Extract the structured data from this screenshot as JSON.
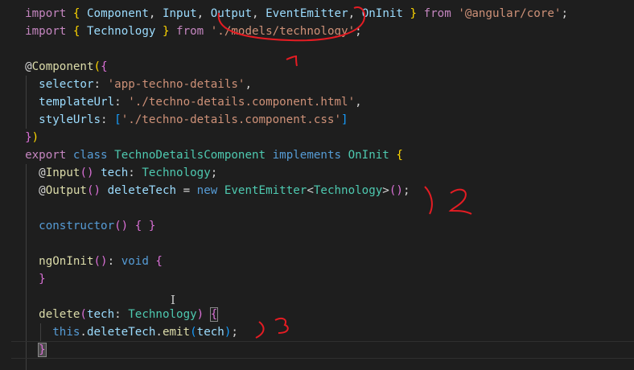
{
  "editor": {
    "language": "typescript",
    "theme_colors": {
      "background": "#1e1e1e",
      "keyword": "#c586c0",
      "storage": "#569cd6",
      "variable": "#9cdcfe",
      "string": "#ce9178",
      "class": "#4ec9b0",
      "function": "#dcdcaa",
      "annotation": "#e51c23"
    },
    "lines": [
      {
        "tokens": [
          [
            "  ",
            "punct"
          ],
          [
            "import",
            "keyword"
          ],
          [
            " ",
            "punct"
          ],
          [
            "{",
            "brace1"
          ],
          [
            " ",
            "punct"
          ],
          [
            "Component",
            "var"
          ],
          [
            ", ",
            "punct"
          ],
          [
            "Input",
            "var"
          ],
          [
            ", ",
            "punct"
          ],
          [
            "Output",
            "var"
          ],
          [
            ", ",
            "punct"
          ],
          [
            "EventEmitter",
            "var"
          ],
          [
            ", ",
            "punct"
          ],
          [
            "OnInit",
            "var"
          ],
          [
            " ",
            "punct"
          ],
          [
            "}",
            "brace1"
          ],
          [
            " ",
            "punct"
          ],
          [
            "from",
            "keyword"
          ],
          [
            " ",
            "punct"
          ],
          [
            "'@angular/core'",
            "string"
          ],
          [
            ";",
            "punct"
          ]
        ]
      },
      {
        "tokens": [
          [
            "  ",
            "punct"
          ],
          [
            "import",
            "keyword"
          ],
          [
            " ",
            "punct"
          ],
          [
            "{",
            "brace1"
          ],
          [
            " ",
            "punct"
          ],
          [
            "Technology",
            "var"
          ],
          [
            " ",
            "punct"
          ],
          [
            "}",
            "brace1"
          ],
          [
            " ",
            "punct"
          ],
          [
            "from",
            "keyword"
          ],
          [
            " ",
            "punct"
          ],
          [
            "'./models/technology'",
            "string"
          ],
          [
            ";",
            "punct"
          ]
        ]
      },
      {
        "tokens": []
      },
      {
        "tokens": [
          [
            "  ",
            "punct"
          ],
          [
            "@",
            "punct"
          ],
          [
            "Component",
            "func"
          ],
          [
            "(",
            "brace1"
          ],
          [
            "{",
            "brace2"
          ]
        ]
      },
      {
        "tokens": [
          [
            "    ",
            "punct"
          ],
          [
            "selector",
            "var"
          ],
          [
            ": ",
            "punct"
          ],
          [
            "'app-techno-details'",
            "string"
          ],
          [
            ",",
            "punct"
          ]
        ]
      },
      {
        "tokens": [
          [
            "    ",
            "punct"
          ],
          [
            "templateUrl",
            "var"
          ],
          [
            ": ",
            "punct"
          ],
          [
            "'./techno-details.component.html'",
            "string"
          ],
          [
            ",",
            "punct"
          ]
        ]
      },
      {
        "tokens": [
          [
            "    ",
            "punct"
          ],
          [
            "styleUrls",
            "var"
          ],
          [
            ": ",
            "punct"
          ],
          [
            "[",
            "brace3"
          ],
          [
            "'./techno-details.component.css'",
            "string"
          ],
          [
            "]",
            "brace3"
          ]
        ]
      },
      {
        "tokens": [
          [
            "  ",
            "punct"
          ],
          [
            "}",
            "brace2"
          ],
          [
            ")",
            "brace1"
          ]
        ]
      },
      {
        "tokens": [
          [
            "  ",
            "punct"
          ],
          [
            "export",
            "keyword"
          ],
          [
            " ",
            "punct"
          ],
          [
            "class",
            "storage"
          ],
          [
            " ",
            "punct"
          ],
          [
            "TechnoDetailsComponent",
            "class"
          ],
          [
            " ",
            "punct"
          ],
          [
            "implements",
            "storage"
          ],
          [
            " ",
            "punct"
          ],
          [
            "OnInit",
            "class"
          ],
          [
            " ",
            "punct"
          ],
          [
            "{",
            "brace1"
          ]
        ]
      },
      {
        "tokens": [
          [
            "    ",
            "punct"
          ],
          [
            "@",
            "punct"
          ],
          [
            "Input",
            "func"
          ],
          [
            "()",
            "brace2"
          ],
          [
            " ",
            "punct"
          ],
          [
            "tech",
            "var"
          ],
          [
            ": ",
            "punct"
          ],
          [
            "Technology",
            "class"
          ],
          [
            ";",
            "punct"
          ]
        ]
      },
      {
        "tokens": [
          [
            "    ",
            "punct"
          ],
          [
            "@",
            "punct"
          ],
          [
            "Output",
            "func"
          ],
          [
            "()",
            "brace2"
          ],
          [
            " ",
            "punct"
          ],
          [
            "deleteTech",
            "var"
          ],
          [
            " = ",
            "punct"
          ],
          [
            "new",
            "storage"
          ],
          [
            " ",
            "punct"
          ],
          [
            "EventEmitter",
            "class"
          ],
          [
            "<",
            "punct"
          ],
          [
            "Technology",
            "class"
          ],
          [
            ">",
            "punct"
          ],
          [
            "()",
            "brace2"
          ],
          [
            ";",
            "punct"
          ]
        ]
      },
      {
        "tokens": []
      },
      {
        "tokens": [
          [
            "    ",
            "punct"
          ],
          [
            "constructor",
            "storage"
          ],
          [
            "()",
            "brace2"
          ],
          [
            " ",
            "punct"
          ],
          [
            "{",
            "brace2"
          ],
          [
            " ",
            "punct"
          ],
          [
            "}",
            "brace2"
          ]
        ]
      },
      {
        "tokens": []
      },
      {
        "tokens": [
          [
            "    ",
            "punct"
          ],
          [
            "ngOnInit",
            "func"
          ],
          [
            "()",
            "brace2"
          ],
          [
            ": ",
            "punct"
          ],
          [
            "void",
            "storage"
          ],
          [
            " ",
            "punct"
          ],
          [
            "{",
            "brace2"
          ]
        ]
      },
      {
        "tokens": [
          [
            "    ",
            "punct"
          ],
          [
            "}",
            "brace2"
          ]
        ]
      },
      {
        "tokens": []
      },
      {
        "tokens": [
          [
            "    ",
            "punct"
          ],
          [
            "delete",
            "func"
          ],
          [
            "(",
            "brace2"
          ],
          [
            "tech",
            "var"
          ],
          [
            ": ",
            "punct"
          ],
          [
            "Technology",
            "class"
          ],
          [
            ")",
            "brace2"
          ],
          [
            " ",
            "punct"
          ],
          [
            "{",
            "brace2-match"
          ]
        ]
      },
      {
        "tokens": [
          [
            "      ",
            "punct"
          ],
          [
            "this",
            "storage"
          ],
          [
            ".",
            "punct"
          ],
          [
            "deleteTech",
            "var"
          ],
          [
            ".",
            "punct"
          ],
          [
            "emit",
            "func"
          ],
          [
            "(",
            "brace3"
          ],
          [
            "tech",
            "var"
          ],
          [
            ")",
            "brace3"
          ],
          [
            ";",
            "punct"
          ]
        ]
      },
      {
        "tokens": [
          [
            "    ",
            "punct"
          ],
          [
            "}",
            "cursor"
          ]
        ],
        "current": true
      }
    ]
  },
  "annotations": [
    {
      "name": "annotation-1",
      "label": "1"
    },
    {
      "name": "annotation-2",
      "label": "2"
    },
    {
      "name": "annotation-3",
      "label": "3"
    }
  ]
}
